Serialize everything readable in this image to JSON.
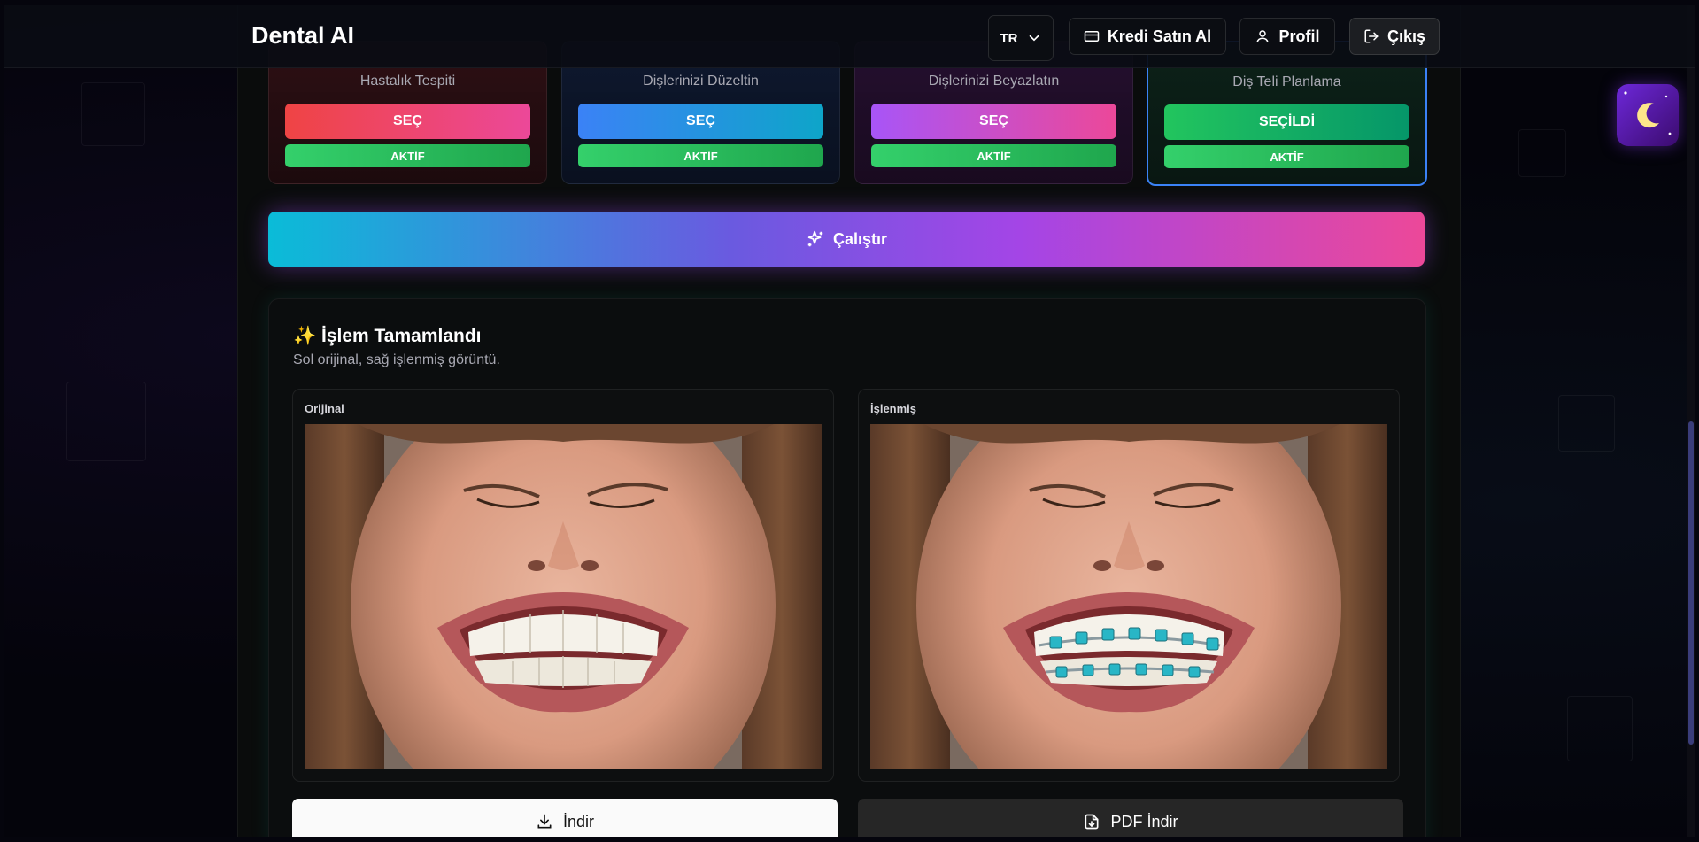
{
  "app": {
    "brand": "Dental AI"
  },
  "nav": {
    "language": "TR",
    "buy_credits": "Kredi Satın Al",
    "profile": "Profil",
    "logout": "Çıkış"
  },
  "cards": [
    {
      "subtitle": "Hastalık Tespiti",
      "button": "SEÇ",
      "status": "AKTİF",
      "gradient": [
        "#ef4444",
        "#ec4899"
      ]
    },
    {
      "subtitle": "Dişlerinizi Düzeltin",
      "button": "SEÇ",
      "status": "AKTİF",
      "gradient": [
        "#3b82f6",
        "#0ea5c9"
      ]
    },
    {
      "subtitle": "Dişlerinizi Beyazlatın",
      "button": "SEÇ",
      "status": "AKTİF",
      "gradient": [
        "#a855f7",
        "#ec4899"
      ]
    },
    {
      "subtitle": "Diş Teli Planlama",
      "button": "SEÇİLDİ",
      "status": "AKTİF",
      "gradient": [
        "#22c55e",
        "#059669"
      ]
    }
  ],
  "run_button": "Çalıştır",
  "result": {
    "emoji": "✨",
    "title": "İşlem Tamamlandı",
    "subtitle": "Sol orijinal, sağ işlenmiş görüntü.",
    "original_label": "Orijinal",
    "processed_label": "İşlenmiş",
    "download": "İndir",
    "pdf_download": "PDF İndir"
  },
  "icons": {
    "language_chevron": "chevron-down-icon",
    "credits": "credit-card-icon",
    "profile": "user-icon",
    "logout": "logout-icon",
    "run": "sparkles-icon",
    "download": "download-icon",
    "pdf": "file-download-icon",
    "theme": "moon-icon"
  },
  "colors": {
    "selected_card_border": "#3b82f6",
    "active_badge": "#22c55e",
    "run_gradient": [
      "#0abcd8",
      "#a445e6",
      "#ec4899"
    ],
    "braces": "#29b6c6"
  }
}
